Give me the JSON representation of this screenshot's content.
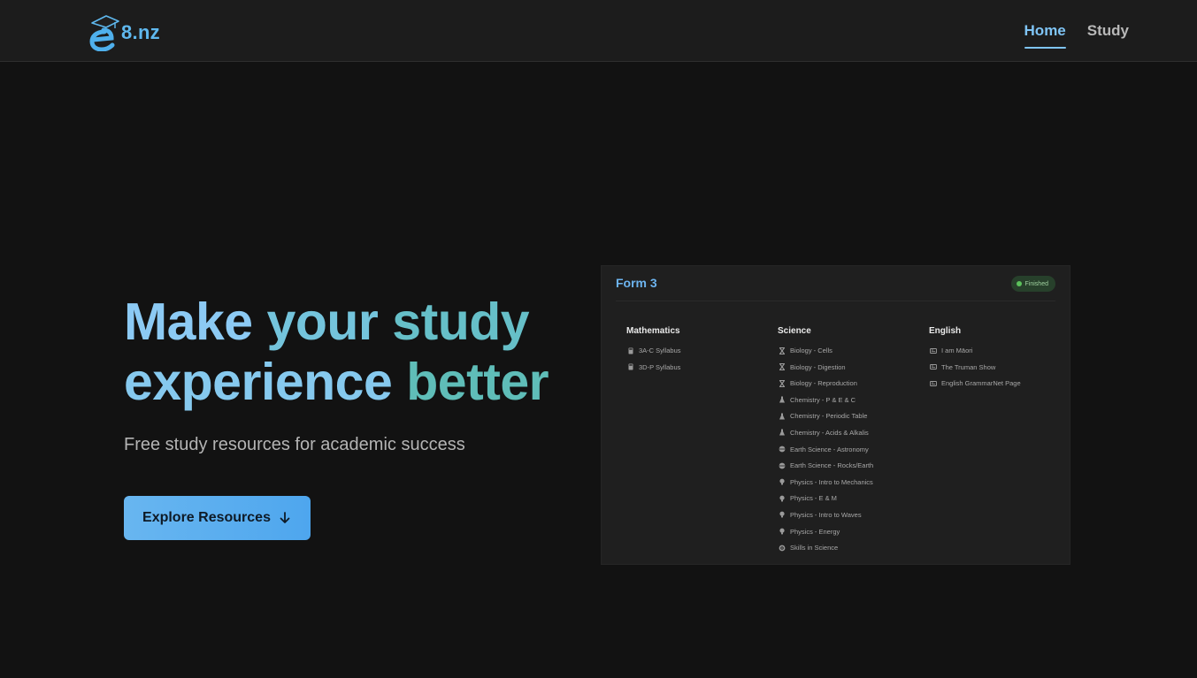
{
  "header": {
    "logo_text": "8.nz",
    "nav": [
      {
        "label": "Home",
        "active": true
      },
      {
        "label": "Study",
        "active": false
      }
    ]
  },
  "hero": {
    "title_line1": [
      "Make",
      "your",
      "study"
    ],
    "title_line2": [
      "experience",
      "better"
    ],
    "subtitle": "Free study resources for academic success",
    "cta_label": "Explore Resources"
  },
  "card": {
    "title": "Form 3",
    "badge": "Finished",
    "columns": [
      {
        "heading": "Mathematics",
        "items": [
          {
            "label": "3A-C Syllabus",
            "icon": "calculator-icon"
          },
          {
            "label": "3D-P Syllabus",
            "icon": "calculator-icon"
          }
        ]
      },
      {
        "heading": "Science",
        "items": [
          {
            "label": "Biology - Cells",
            "icon": "dna-icon"
          },
          {
            "label": "Biology - Digestion",
            "icon": "dna-icon"
          },
          {
            "label": "Biology - Reproduction",
            "icon": "dna-icon"
          },
          {
            "label": "Chemistry - P & E & C",
            "icon": "flask-icon"
          },
          {
            "label": "Chemistry - Periodic Table",
            "icon": "flask-icon"
          },
          {
            "label": "Chemistry - Acids & Alkalis",
            "icon": "flask-icon"
          },
          {
            "label": "Earth Science - Astronomy",
            "icon": "globe-icon"
          },
          {
            "label": "Earth Science - Rocks/Earth",
            "icon": "globe-icon"
          },
          {
            "label": "Physics - Intro to Mechanics",
            "icon": "bulb-icon"
          },
          {
            "label": "Physics - E & M",
            "icon": "bulb-icon"
          },
          {
            "label": "Physics - Intro to Waves",
            "icon": "bulb-icon"
          },
          {
            "label": "Physics - Energy",
            "icon": "bulb-icon"
          },
          {
            "label": "Skills in Science",
            "icon": "gear-icon"
          }
        ]
      },
      {
        "heading": "English",
        "items": [
          {
            "label": "I am Māori",
            "icon": "newspaper-icon"
          },
          {
            "label": "The Truman Show",
            "icon": "newspaper-icon"
          },
          {
            "label": "English GrammarNet Page",
            "icon": "newspaper-icon"
          }
        ]
      }
    ]
  },
  "colors": {
    "background": "#121212",
    "header": "#1c1c1c",
    "accent": "#7fc4f5",
    "button": "#5aaef0",
    "badge_dot": "#5cc25c"
  }
}
